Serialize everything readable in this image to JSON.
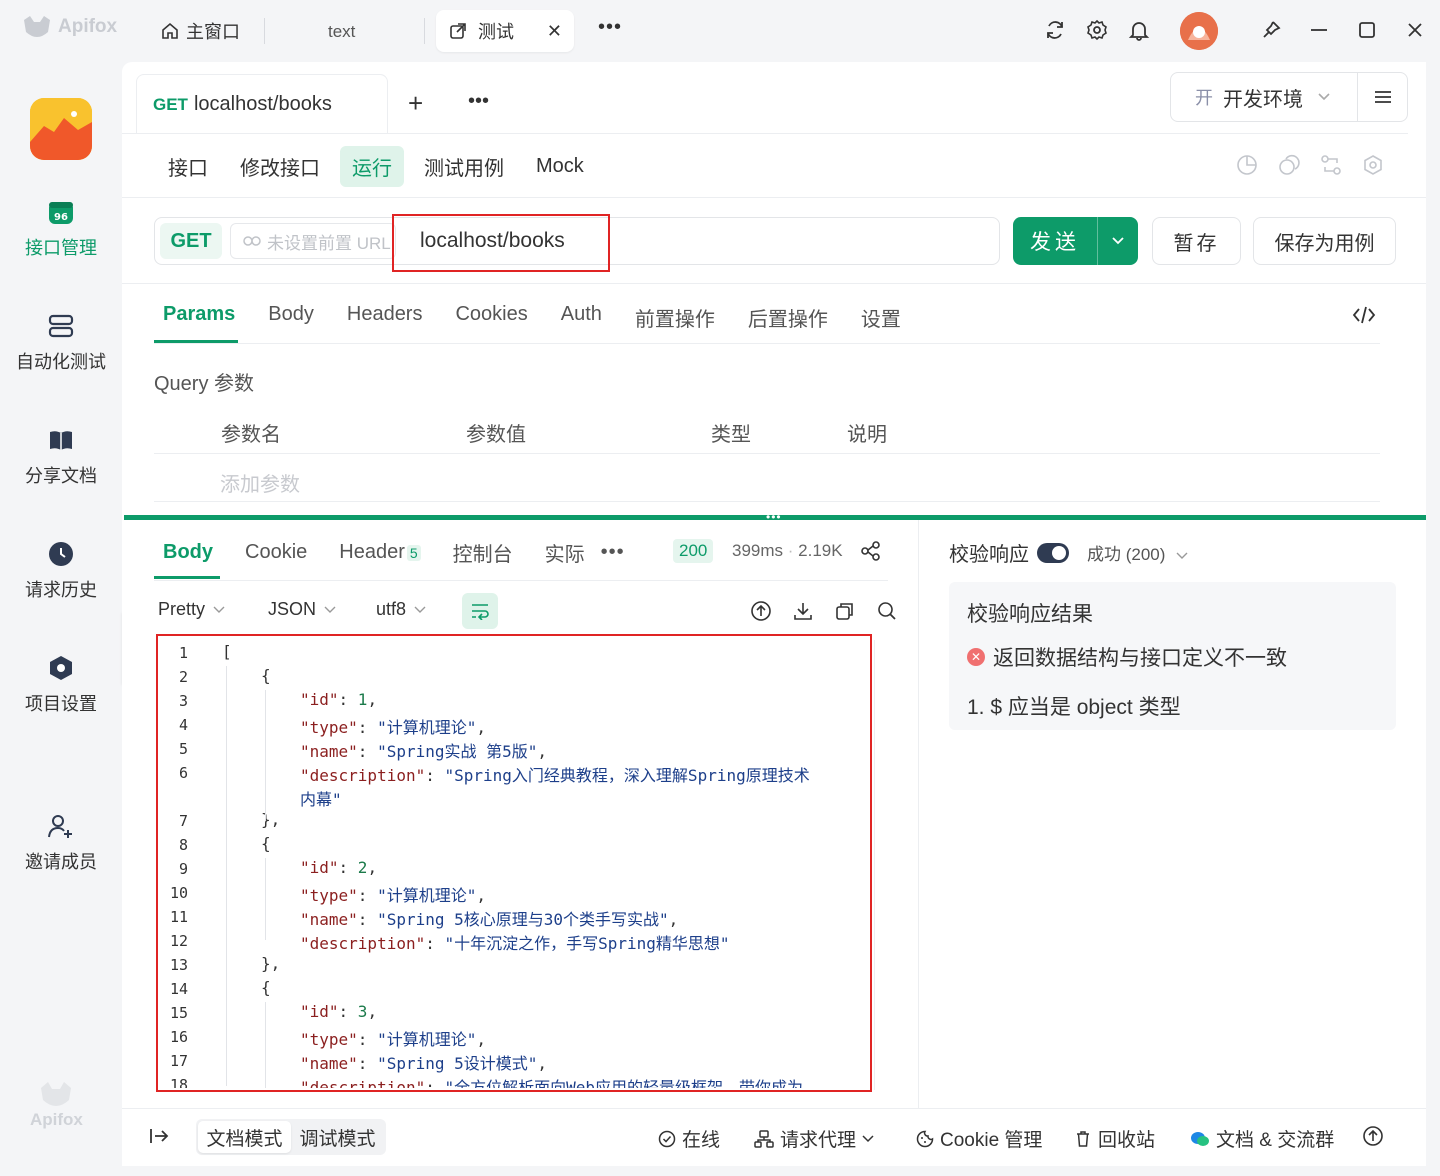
{
  "app": {
    "name": "Apifox"
  },
  "top_tabs": {
    "home": "主窗口",
    "text": "text",
    "active": "测试"
  },
  "sidebar": {
    "items": [
      {
        "label": "接口管理",
        "icon": "api-icon",
        "active": true
      },
      {
        "label": "自动化测试",
        "icon": "automation-icon"
      },
      {
        "label": "分享文档",
        "icon": "book-icon"
      },
      {
        "label": "请求历史",
        "icon": "clock-icon"
      },
      {
        "label": "项目设置",
        "icon": "settings-icon"
      },
      {
        "label": "邀请成员",
        "icon": "add-user-icon"
      }
    ],
    "footer": "Apifox"
  },
  "request_tab": {
    "method": "GET",
    "title": "localhost/books"
  },
  "env": {
    "badge": "开",
    "name": "开发环境"
  },
  "sub_tabs": [
    "接口",
    "修改接口",
    "运行",
    "测试用例",
    "Mock"
  ],
  "sub_tab_active": "运行",
  "url_bar": {
    "method": "GET",
    "prefix_placeholder": "未设置前置 URL",
    "url": "localhost/books",
    "send": "发送",
    "save": "暂存",
    "save_case": "保存为用例"
  },
  "param_tabs": [
    "Params",
    "Body",
    "Headers",
    "Cookies",
    "Auth",
    "前置操作",
    "后置操作",
    "设置"
  ],
  "query": {
    "title": "Query 参数",
    "columns": [
      "参数名",
      "参数值",
      "类型",
      "说明"
    ],
    "add": "添加参数"
  },
  "response": {
    "tabs": {
      "body": "Body",
      "cookie": "Cookie",
      "header": "Header",
      "header_count": "5",
      "console": "控制台",
      "actual": "实际"
    },
    "status": "200",
    "time": "399ms",
    "size": "2.19K",
    "format": {
      "pretty": "Pretty",
      "lang": "JSON",
      "charset": "utf8"
    },
    "lines": [
      {
        "n": "1",
        "ind": 0,
        "parts": [
          [
            "p",
            "["
          ]
        ]
      },
      {
        "n": "2",
        "ind": 1,
        "parts": [
          [
            "p",
            "{"
          ]
        ]
      },
      {
        "n": "3",
        "ind": 2,
        "parts": [
          [
            "k",
            "\"id\""
          ],
          [
            "p",
            ": "
          ],
          [
            "n",
            "1"
          ],
          [
            "p",
            ","
          ]
        ]
      },
      {
        "n": "4",
        "ind": 2,
        "parts": [
          [
            "k",
            "\"type\""
          ],
          [
            "p",
            ": "
          ],
          [
            "s",
            "\"计算机理论\""
          ],
          [
            "p",
            ","
          ]
        ]
      },
      {
        "n": "5",
        "ind": 2,
        "parts": [
          [
            "k",
            "\"name\""
          ],
          [
            "p",
            ": "
          ],
          [
            "s",
            "\"Spring实战 第5版\""
          ],
          [
            "p",
            ","
          ]
        ]
      },
      {
        "n": "6",
        "ind": 2,
        "parts": [
          [
            "k",
            "\"description\""
          ],
          [
            "p",
            ": "
          ],
          [
            "s",
            "\"Spring入门经典教程，深入理解Spring原理技术"
          ]
        ]
      },
      {
        "n": "",
        "ind": 2,
        "parts": [
          [
            "s",
            "内幕\""
          ]
        ]
      },
      {
        "n": "7",
        "ind": 1,
        "parts": [
          [
            "p",
            "},"
          ]
        ]
      },
      {
        "n": "8",
        "ind": 1,
        "parts": [
          [
            "p",
            "{"
          ]
        ]
      },
      {
        "n": "9",
        "ind": 2,
        "parts": [
          [
            "k",
            "\"id\""
          ],
          [
            "p",
            ": "
          ],
          [
            "n",
            "2"
          ],
          [
            "p",
            ","
          ]
        ]
      },
      {
        "n": "10",
        "ind": 2,
        "parts": [
          [
            "k",
            "\"type\""
          ],
          [
            "p",
            ": "
          ],
          [
            "s",
            "\"计算机理论\""
          ],
          [
            "p",
            ","
          ]
        ]
      },
      {
        "n": "11",
        "ind": 2,
        "parts": [
          [
            "k",
            "\"name\""
          ],
          [
            "p",
            ": "
          ],
          [
            "s",
            "\"Spring 5核心原理与30个类手写实战\""
          ],
          [
            "p",
            ","
          ]
        ]
      },
      {
        "n": "12",
        "ind": 2,
        "parts": [
          [
            "k",
            "\"description\""
          ],
          [
            "p",
            ": "
          ],
          [
            "s",
            "\"十年沉淀之作，手写Spring精华思想\""
          ]
        ]
      },
      {
        "n": "13",
        "ind": 1,
        "parts": [
          [
            "p",
            "},"
          ]
        ]
      },
      {
        "n": "14",
        "ind": 1,
        "parts": [
          [
            "p",
            "{"
          ]
        ]
      },
      {
        "n": "15",
        "ind": 2,
        "parts": [
          [
            "k",
            "\"id\""
          ],
          [
            "p",
            ": "
          ],
          [
            "n",
            "3"
          ],
          [
            "p",
            ","
          ]
        ]
      },
      {
        "n": "16",
        "ind": 2,
        "parts": [
          [
            "k",
            "\"type\""
          ],
          [
            "p",
            ": "
          ],
          [
            "s",
            "\"计算机理论\""
          ],
          [
            "p",
            ","
          ]
        ]
      },
      {
        "n": "17",
        "ind": 2,
        "parts": [
          [
            "k",
            "\"name\""
          ],
          [
            "p",
            ": "
          ],
          [
            "s",
            "\"Spring 5设计模式\""
          ],
          [
            "p",
            ","
          ]
        ]
      },
      {
        "n": "18",
        "ind": 2,
        "parts": [
          [
            "k",
            "\"description\""
          ],
          [
            "p",
            ": "
          ],
          [
            "s",
            "\"全方位解析面向Web应用的轻量级框架，带你成为"
          ]
        ]
      }
    ]
  },
  "validate": {
    "label": "校验响应",
    "status": "成功 (200)",
    "result_title": "校验响应结果",
    "error": "返回数据结构与接口定义不一致",
    "detail": "1. $ 应当是 object 类型"
  },
  "footer": {
    "doc_mode": "文档模式",
    "debug_mode": "调试模式",
    "online": "在线",
    "proxy": "请求代理",
    "cookie": "Cookie 管理",
    "trash": "回收站",
    "docs": "文档 & 交流群"
  },
  "colors": {
    "accent": "#0d9b69",
    "highlight_box": "#e02424"
  }
}
